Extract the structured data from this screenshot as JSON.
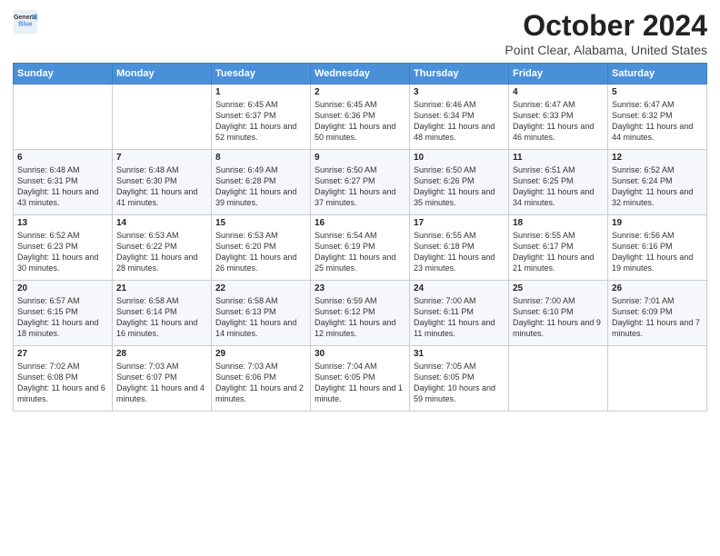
{
  "logo": {
    "line1": "General",
    "line2": "Blue"
  },
  "title": "October 2024",
  "subtitle": "Point Clear, Alabama, United States",
  "days_header": [
    "Sunday",
    "Monday",
    "Tuesday",
    "Wednesday",
    "Thursday",
    "Friday",
    "Saturday"
  ],
  "weeks": [
    [
      {
        "day": "",
        "text": ""
      },
      {
        "day": "",
        "text": ""
      },
      {
        "day": "1",
        "text": "Sunrise: 6:45 AM\nSunset: 6:37 PM\nDaylight: 11 hours and 52 minutes."
      },
      {
        "day": "2",
        "text": "Sunrise: 6:45 AM\nSunset: 6:36 PM\nDaylight: 11 hours and 50 minutes."
      },
      {
        "day": "3",
        "text": "Sunrise: 6:46 AM\nSunset: 6:34 PM\nDaylight: 11 hours and 48 minutes."
      },
      {
        "day": "4",
        "text": "Sunrise: 6:47 AM\nSunset: 6:33 PM\nDaylight: 11 hours and 46 minutes."
      },
      {
        "day": "5",
        "text": "Sunrise: 6:47 AM\nSunset: 6:32 PM\nDaylight: 11 hours and 44 minutes."
      }
    ],
    [
      {
        "day": "6",
        "text": "Sunrise: 6:48 AM\nSunset: 6:31 PM\nDaylight: 11 hours and 43 minutes."
      },
      {
        "day": "7",
        "text": "Sunrise: 6:48 AM\nSunset: 6:30 PM\nDaylight: 11 hours and 41 minutes."
      },
      {
        "day": "8",
        "text": "Sunrise: 6:49 AM\nSunset: 6:28 PM\nDaylight: 11 hours and 39 minutes."
      },
      {
        "day": "9",
        "text": "Sunrise: 6:50 AM\nSunset: 6:27 PM\nDaylight: 11 hours and 37 minutes."
      },
      {
        "day": "10",
        "text": "Sunrise: 6:50 AM\nSunset: 6:26 PM\nDaylight: 11 hours and 35 minutes."
      },
      {
        "day": "11",
        "text": "Sunrise: 6:51 AM\nSunset: 6:25 PM\nDaylight: 11 hours and 34 minutes."
      },
      {
        "day": "12",
        "text": "Sunrise: 6:52 AM\nSunset: 6:24 PM\nDaylight: 11 hours and 32 minutes."
      }
    ],
    [
      {
        "day": "13",
        "text": "Sunrise: 6:52 AM\nSunset: 6:23 PM\nDaylight: 11 hours and 30 minutes."
      },
      {
        "day": "14",
        "text": "Sunrise: 6:53 AM\nSunset: 6:22 PM\nDaylight: 11 hours and 28 minutes."
      },
      {
        "day": "15",
        "text": "Sunrise: 6:53 AM\nSunset: 6:20 PM\nDaylight: 11 hours and 26 minutes."
      },
      {
        "day": "16",
        "text": "Sunrise: 6:54 AM\nSunset: 6:19 PM\nDaylight: 11 hours and 25 minutes."
      },
      {
        "day": "17",
        "text": "Sunrise: 6:55 AM\nSunset: 6:18 PM\nDaylight: 11 hours and 23 minutes."
      },
      {
        "day": "18",
        "text": "Sunrise: 6:55 AM\nSunset: 6:17 PM\nDaylight: 11 hours and 21 minutes."
      },
      {
        "day": "19",
        "text": "Sunrise: 6:56 AM\nSunset: 6:16 PM\nDaylight: 11 hours and 19 minutes."
      }
    ],
    [
      {
        "day": "20",
        "text": "Sunrise: 6:57 AM\nSunset: 6:15 PM\nDaylight: 11 hours and 18 minutes."
      },
      {
        "day": "21",
        "text": "Sunrise: 6:58 AM\nSunset: 6:14 PM\nDaylight: 11 hours and 16 minutes."
      },
      {
        "day": "22",
        "text": "Sunrise: 6:58 AM\nSunset: 6:13 PM\nDaylight: 11 hours and 14 minutes."
      },
      {
        "day": "23",
        "text": "Sunrise: 6:59 AM\nSunset: 6:12 PM\nDaylight: 11 hours and 12 minutes."
      },
      {
        "day": "24",
        "text": "Sunrise: 7:00 AM\nSunset: 6:11 PM\nDaylight: 11 hours and 11 minutes."
      },
      {
        "day": "25",
        "text": "Sunrise: 7:00 AM\nSunset: 6:10 PM\nDaylight: 11 hours and 9 minutes."
      },
      {
        "day": "26",
        "text": "Sunrise: 7:01 AM\nSunset: 6:09 PM\nDaylight: 11 hours and 7 minutes."
      }
    ],
    [
      {
        "day": "27",
        "text": "Sunrise: 7:02 AM\nSunset: 6:08 PM\nDaylight: 11 hours and 6 minutes."
      },
      {
        "day": "28",
        "text": "Sunrise: 7:03 AM\nSunset: 6:07 PM\nDaylight: 11 hours and 4 minutes."
      },
      {
        "day": "29",
        "text": "Sunrise: 7:03 AM\nSunset: 6:06 PM\nDaylight: 11 hours and 2 minutes."
      },
      {
        "day": "30",
        "text": "Sunrise: 7:04 AM\nSunset: 6:05 PM\nDaylight: 11 hours and 1 minute."
      },
      {
        "day": "31",
        "text": "Sunrise: 7:05 AM\nSunset: 6:05 PM\nDaylight: 10 hours and 59 minutes."
      },
      {
        "day": "",
        "text": ""
      },
      {
        "day": "",
        "text": ""
      }
    ]
  ]
}
